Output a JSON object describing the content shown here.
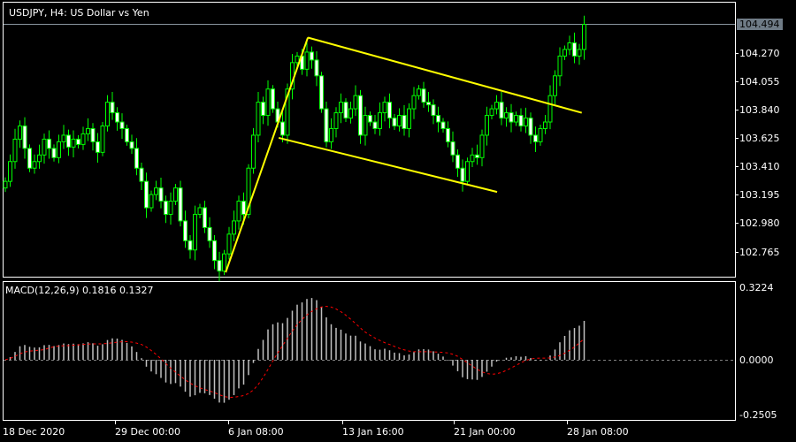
{
  "window": {
    "title": "USDJPY, H4:  US Dollar vs Yen"
  },
  "price_axis": {
    "current": "104.494",
    "ticks": [
      "104.270",
      "104.055",
      "103.840",
      "103.625",
      "103.410",
      "103.195",
      "102.980",
      "102.765"
    ]
  },
  "macd_panel": {
    "label": "MACD(12,26,9) 0.1816 0.1327",
    "ticks": [
      "0.3224",
      "0.0000",
      "-0.2505"
    ]
  },
  "time_axis": {
    "labels": [
      "18 Dec 2020",
      "29 Dec 00:00",
      "6 Jan 08:00",
      "13 Jan 16:00",
      "21 Jan 00:00",
      "28 Jan 08:00"
    ]
  },
  "colors": {
    "candle": "#00ff00",
    "bear_body": "#ffffff",
    "bull_body": "#000000",
    "trendline": "#ffff00",
    "macd_hist": "#c0c0c0",
    "signal": "#ff0000",
    "frame": "#ffffff"
  },
  "chart_data": {
    "type": "candlestick",
    "title": "USDJPY, H4",
    "ylim": [
      102.58,
      104.55
    ],
    "macd_ylim": [
      -0.2505,
      0.3224
    ],
    "open_start": 103.25,
    "close": [
      103.3,
      103.45,
      103.62,
      103.72,
      103.55,
      103.4,
      103.45,
      103.5,
      103.62,
      103.55,
      103.48,
      103.6,
      103.65,
      103.56,
      103.62,
      103.58,
      103.66,
      103.7,
      103.6,
      103.52,
      103.72,
      103.9,
      103.82,
      103.75,
      103.7,
      103.6,
      103.55,
      103.4,
      103.3,
      103.1,
      103.2,
      103.25,
      103.15,
      103.05,
      103.15,
      103.25,
      103.0,
      102.85,
      102.78,
      103.05,
      103.1,
      102.95,
      102.85,
      102.7,
      102.62,
      102.75,
      102.9,
      103.0,
      103.15,
      103.05,
      103.4,
      103.65,
      103.9,
      103.8,
      104.0,
      103.85,
      103.75,
      103.65,
      104.0,
      104.2,
      104.25,
      104.15,
      104.28,
      104.22,
      104.1,
      103.85,
      103.6,
      103.7,
      103.82,
      103.9,
      103.78,
      103.85,
      103.95,
      103.65,
      103.8,
      103.75,
      103.7,
      103.82,
      103.9,
      103.78,
      103.72,
      103.8,
      103.7,
      103.85,
      103.95,
      104.0,
      103.9,
      103.88,
      103.8,
      103.75,
      103.7,
      103.6,
      103.5,
      103.4,
      103.3,
      103.45,
      103.5,
      103.48,
      103.65,
      103.8,
      103.85,
      103.9,
      103.78,
      103.82,
      103.75,
      103.8,
      103.72,
      103.78,
      103.65,
      103.6,
      103.7,
      103.75,
      103.95,
      104.1,
      104.25,
      104.3,
      104.35,
      104.25,
      104.3,
      104.49
    ],
    "trendlines": [
      {
        "from": [
          45.3,
          102.61
        ],
        "to": [
          62.2,
          104.39
        ]
      },
      {
        "from": [
          62.2,
          104.39
        ],
        "to": [
          118.5,
          103.82
        ]
      },
      {
        "from": [
          56.2,
          103.63
        ],
        "to": [
          101.1,
          103.22
        ]
      }
    ],
    "macd": {
      "fast": 12,
      "slow": 26,
      "signal": 9,
      "last_main": 0.1816,
      "last_signal": 0.1327
    }
  }
}
